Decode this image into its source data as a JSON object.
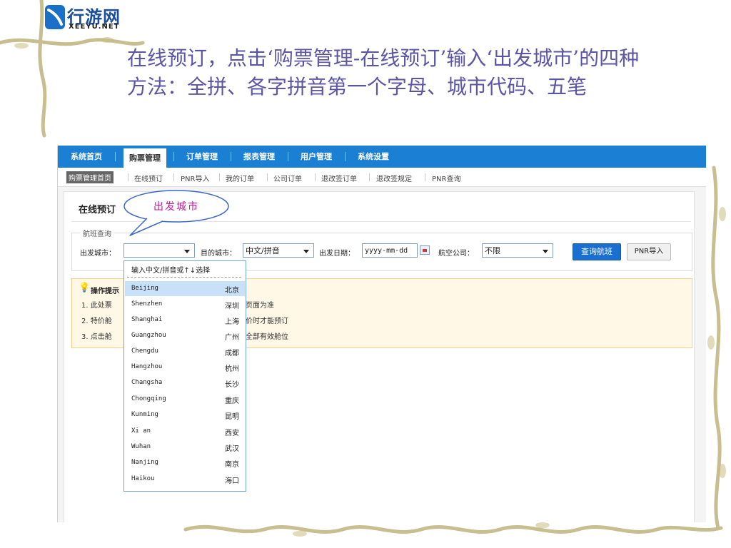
{
  "logo": {
    "cn": "行游网",
    "en": "XEEYU.NET"
  },
  "heading": "在线预订，点击‘购票管理-在线预订’输入‘出发城市’的四种方法：全拼、各字拼音第一个字母、城市代码、五笔",
  "callout": "出发城市",
  "nav": {
    "items": [
      "系统首页",
      "购票管理",
      "订单管理",
      "报表管理",
      "用户管理",
      "系统设置"
    ],
    "active": "购票管理"
  },
  "subnav": {
    "items": [
      "购票管理首页",
      "在线预订",
      "PNR导入",
      "我的订单",
      "公司订单",
      "退改签订单",
      "退改签规定",
      "PNR查询"
    ]
  },
  "panel": {
    "title": "在线预订",
    "legend": "航班查询"
  },
  "search": {
    "from_label": "出发城市：",
    "from_value": "",
    "to_label": "目的城市：",
    "to_value": "中文/拼音",
    "date_label": "出发日期：",
    "date_value": "yyyy-mm-dd",
    "airline_label": "航空公司：",
    "airline_value": "不限",
    "query_button": "查询航班",
    "pnr_button": "PNR导入"
  },
  "tips": {
    "title": "操作提示",
    "items": [
      {
        "left": "1. 此处票",
        "right": "页面为准"
      },
      {
        "left": "2. 特价舱",
        "right": "价时才能预订"
      },
      {
        "left": "3. 点击舱",
        "right": "全部有效舱位"
      }
    ]
  },
  "dropdown": {
    "hint": "输入中文/拼音或↑↓选择",
    "cities": [
      {
        "py": "Beijing",
        "cn": "北京"
      },
      {
        "py": "Shenzhen",
        "cn": "深圳"
      },
      {
        "py": "Shanghai",
        "cn": "上海"
      },
      {
        "py": "Guangzhou",
        "cn": "广州"
      },
      {
        "py": "Chengdu",
        "cn": "成都"
      },
      {
        "py": "Hangzhou",
        "cn": "杭州"
      },
      {
        "py": "Changsha",
        "cn": "长沙"
      },
      {
        "py": "Chongqing",
        "cn": "重庆"
      },
      {
        "py": "Kunming",
        "cn": "昆明"
      },
      {
        "py": "Xi an",
        "cn": "西安"
      },
      {
        "py": "Wuhan",
        "cn": "武汉"
      },
      {
        "py": "Nanjing",
        "cn": "南京"
      },
      {
        "py": "Haikou",
        "cn": "海口"
      }
    ]
  },
  "colors": {
    "nav": "#1b7fd4",
    "heading": "#5b55a8",
    "callout": "#d0159a",
    "highlight": "#c8e0f8"
  }
}
